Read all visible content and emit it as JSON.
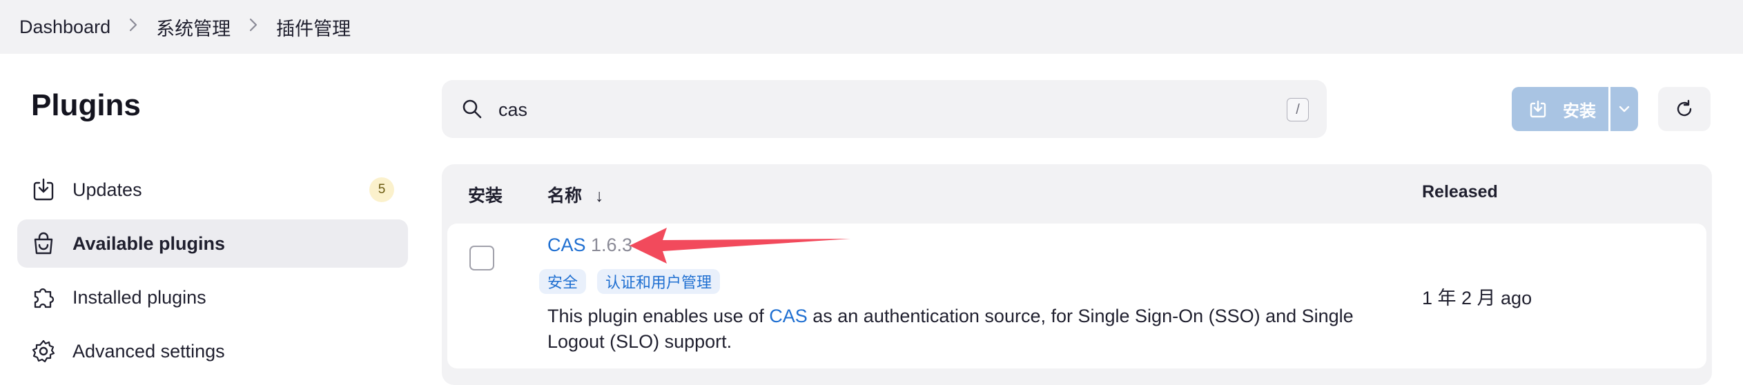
{
  "breadcrumb": {
    "items": [
      "Dashboard",
      "系统管理",
      "插件管理"
    ]
  },
  "page": {
    "title": "Plugins"
  },
  "sidebar": {
    "items": [
      {
        "label": "Updates",
        "badge": "5",
        "icon": "download-icon"
      },
      {
        "label": "Available plugins",
        "icon": "shopping-bag-icon",
        "active": true
      },
      {
        "label": "Installed plugins",
        "icon": "puzzle-icon"
      },
      {
        "label": "Advanced settings",
        "icon": "gear-icon"
      }
    ]
  },
  "search": {
    "value": "cas",
    "shortcut": "/"
  },
  "toolbar": {
    "install_label": "安装",
    "accent": "#a9c4e3"
  },
  "table": {
    "headers": {
      "install": "安装",
      "name": "名称",
      "name_sort": "↓",
      "released": "Released"
    },
    "rows": [
      {
        "name": "CAS",
        "version": "1.6.3",
        "tags": [
          "安全",
          "认证和用户管理"
        ],
        "desc_before": "This plugin enables use of ",
        "desc_link": "CAS",
        "desc_after": " as an authentication source, for Single Sign-On (SSO) and Single Logout (SLO) support.",
        "released": "1 年 2 月 ago"
      }
    ]
  },
  "annotation": {
    "color": "#f24a5c"
  }
}
